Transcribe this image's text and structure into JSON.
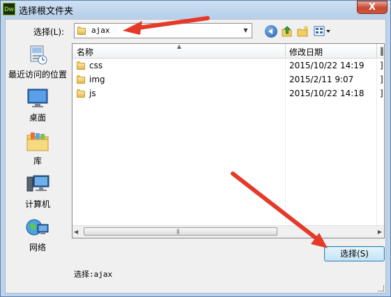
{
  "window": {
    "app_icon_text": "Dw",
    "title": "选择根文件夹",
    "close_symbol": "X"
  },
  "toolbar": {
    "look_in_label": "选择(L):",
    "look_in_value": "ajax",
    "dropdown_symbol": "▼",
    "icons": [
      "back-icon",
      "up-folder-icon",
      "new-folder-icon",
      "views-menu-icon"
    ]
  },
  "places": [
    {
      "label": "最近访问的位置",
      "icon": "recent-places-icon"
    },
    {
      "label": "桌面",
      "icon": "desktop-icon"
    },
    {
      "label": "库",
      "icon": "libraries-icon"
    },
    {
      "label": "计算机",
      "icon": "computer-icon"
    },
    {
      "label": "网络",
      "icon": "network-icon"
    }
  ],
  "file_list": {
    "columns": [
      "名称",
      "修改日期"
    ],
    "sort_symbol": "▲",
    "rows": [
      {
        "name": "css",
        "modified": "2015/10/22 14:19"
      },
      {
        "name": "img",
        "modified": "2015/2/11 9:07"
      },
      {
        "name": "js",
        "modified": "2015/10/22 14:18"
      }
    ]
  },
  "footer": {
    "select_button_label": "选择(S)",
    "status_text": "选择:ajax"
  },
  "colors": {
    "title_bar": "#c4d8ef",
    "close_button": "#c8462e",
    "annotation_arrow": "#e53a2a"
  }
}
